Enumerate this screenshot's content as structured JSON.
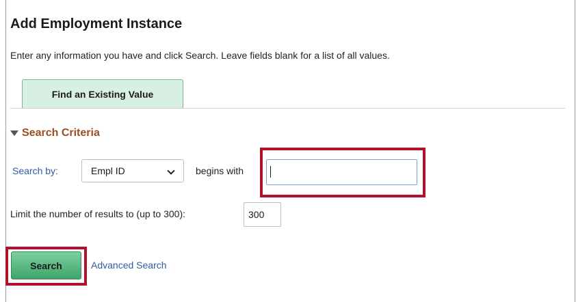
{
  "page": {
    "title": "Add Employment Instance",
    "instructions": "Enter any information you have and click Search. Leave fields blank for a list of all values."
  },
  "tabs": [
    {
      "label": "Find an Existing Value",
      "active": true
    }
  ],
  "search_criteria": {
    "header": "Search Criteria",
    "icon": "collapse-triangle-icon",
    "search_by_label": "Search by:",
    "search_by_selected": "Empl ID",
    "operator_label": "begins with",
    "search_value": "",
    "limit_label": "Limit the number of results to (up to 300):",
    "limit_value": "300"
  },
  "actions": {
    "search_label": "Search",
    "advanced_search_label": "Advanced Search"
  },
  "colors": {
    "highlight": "#b0122b",
    "tab_background": "#d8f0e2",
    "section_header": "#9b4f1e",
    "link": "#2a5d9a",
    "search_button": "#4caf78"
  }
}
